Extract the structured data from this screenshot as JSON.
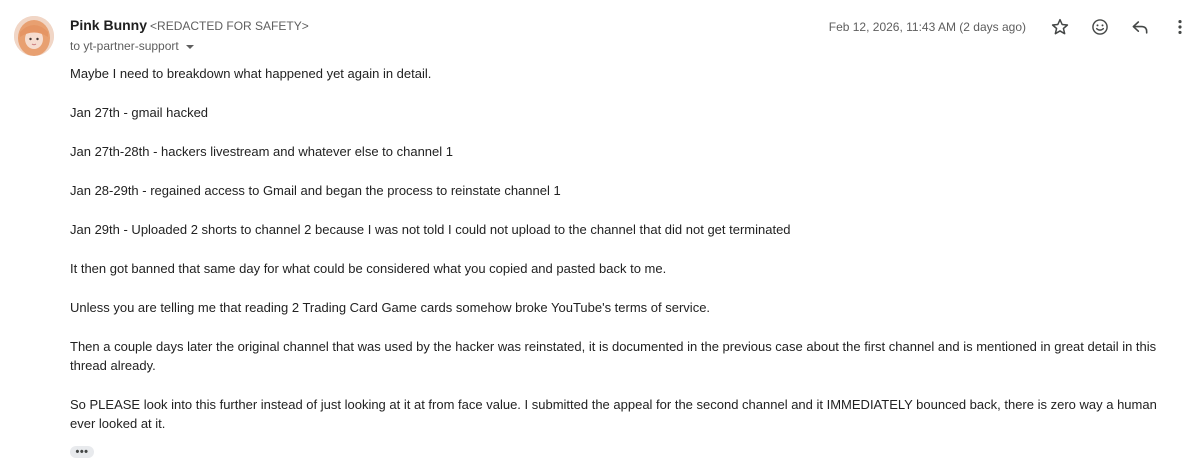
{
  "sender": {
    "name": "Pink Bunny",
    "email": "<REDACTED FOR SAFETY>"
  },
  "recipient_line": "to yt-partner-support",
  "date_text": "Feb 12, 2026, 11:43 AM (2 days ago)",
  "icons": {
    "avatar": "profile-photo",
    "recipient_toggle": "caret-down-icon",
    "star": "star-icon",
    "emoji": "smiley-face-icon",
    "reply": "reply-arrow-icon",
    "more": "vertical-dots-icon",
    "trimmed": "horizontal-dots-icon"
  },
  "body": [
    "Maybe I need to breakdown what happened yet again in detail.",
    "Jan 27th - gmail hacked",
    "Jan 27th-28th - hackers livestream and whatever else to channel 1",
    "Jan 28-29th - regained access to Gmail and began the process to reinstate channel 1",
    "Jan 29th - Uploaded 2 shorts to channel 2 because I was not told I could not upload to the channel that did not get terminated",
    "It then got banned that same day for what could be considered what you copied and pasted back to me.",
    "Unless you are telling me that reading 2 Trading Card Game cards somehow broke YouTube's terms of service.",
    "Then a couple days later the original channel that was used by the hacker was reinstated, it is documented in the previous case about the first channel and is mentioned in great detail in this thread already.",
    "So PLEASE look into this further instead of just looking at it at from face value. I submitted the appeal for the second channel and it IMMEDIATELY bounced back, there is zero way a human ever looked at it."
  ],
  "trimmed_content": "•••"
}
